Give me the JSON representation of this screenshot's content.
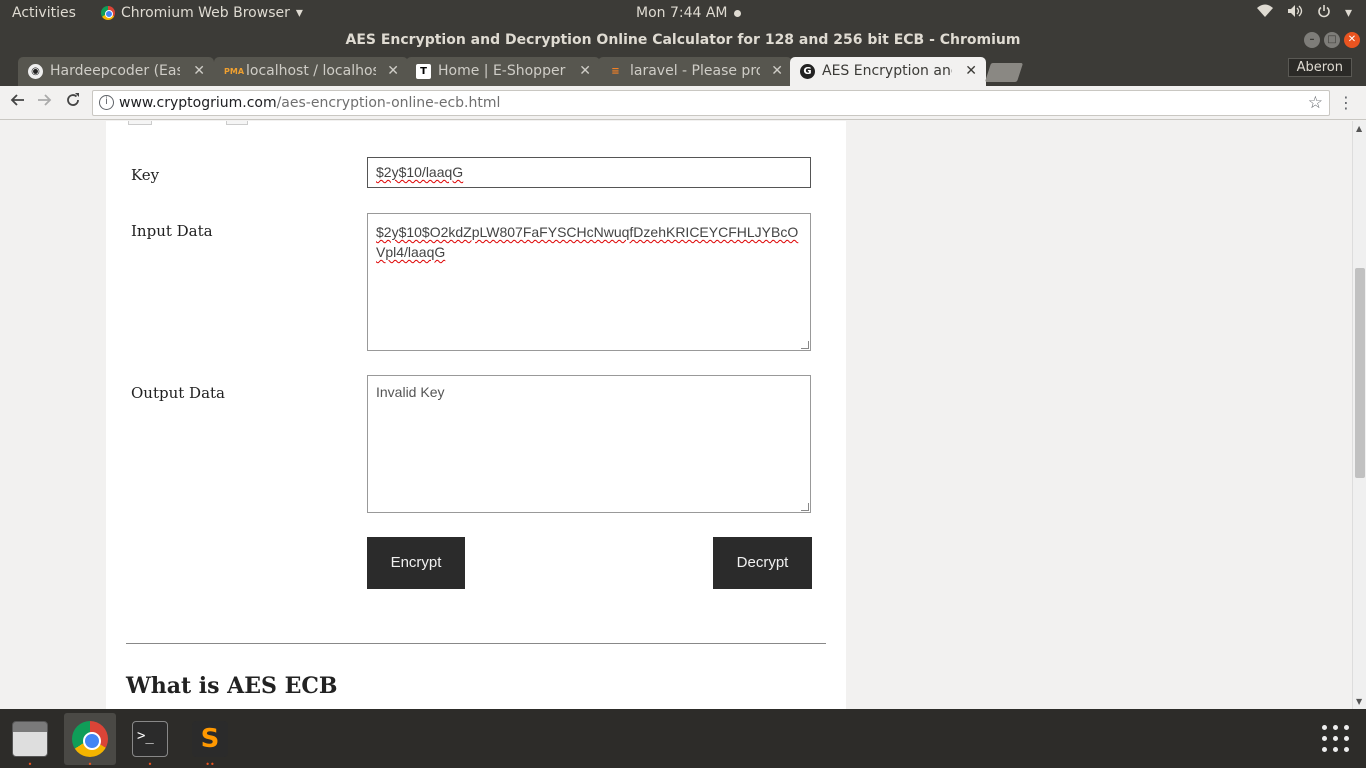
{
  "system_bar": {
    "activities": "Activities",
    "app_menu": "Chromium Web Browser",
    "clock": "Mon  7:44 AM",
    "icons": [
      "wifi-icon",
      "volume-icon",
      "power-icon"
    ]
  },
  "window": {
    "title": "AES Encryption and Decryption Online Calculator for 128 and 256 bit ECB - Chromium"
  },
  "tabs": [
    {
      "label": "Hardeepcoder (Eas",
      "icon": "github-icon"
    },
    {
      "label": "localhost / localhos",
      "icon": "phpmyadmin-icon"
    },
    {
      "label": "Home | E-Shopper",
      "icon": "t-icon"
    },
    {
      "label": "laravel - Please prov",
      "icon": "stackoverflow-icon"
    },
    {
      "label": "AES Encryption and",
      "icon": "google-icon"
    }
  ],
  "profile": "Aberon",
  "address_bar": {
    "host": "www.cryptogrium.com",
    "path": "/aes-encryption-online-ecb.html"
  },
  "form": {
    "key_label": "Key",
    "key_value": "$2y$10/laaqG",
    "input_label": "Input Data",
    "input_value": "$2y$10$O2kdZpLW807FaFYSCHcNwuqfDzehKRICEYCFHLJYBcOVpl4/laaqG",
    "output_label": "Output Data",
    "output_value": "Invalid Key",
    "encrypt_label": "Encrypt",
    "decrypt_label": "Decrypt"
  },
  "section_heading": "What is AES ECB",
  "dock": {
    "apps": [
      "files-icon",
      "chromium-icon",
      "terminal-icon",
      "sublime-text-icon"
    ],
    "show_apps": "show-applications-icon"
  },
  "colors": {
    "accent": "#e95420",
    "button_bg": "#2b2b2b",
    "ubuntu_bar": "#3c3b37"
  }
}
